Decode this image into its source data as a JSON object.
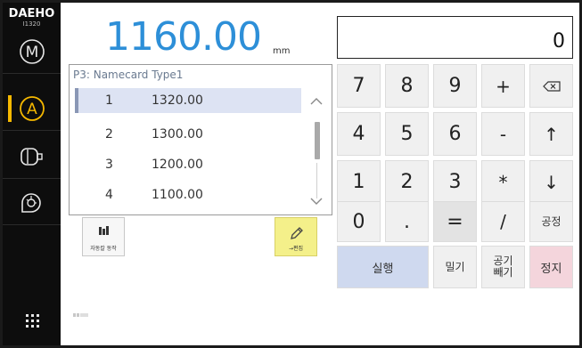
{
  "brand": {
    "name": "DAEHO",
    "model": "I1320"
  },
  "sidebar": {
    "items": [
      {
        "name": "manual-mode",
        "glyph": "M",
        "active": false
      },
      {
        "name": "auto-mode",
        "glyph": "A",
        "active": true
      },
      {
        "name": "motor",
        "active": false
      },
      {
        "name": "blower",
        "active": false
      },
      {
        "name": "menu",
        "active": false
      }
    ],
    "active_color": "#f5b800"
  },
  "display": {
    "value": "1160.00",
    "unit": "mm",
    "value_color": "#2d8fd8"
  },
  "calculator": {
    "display_value": "0"
  },
  "program": {
    "title": "P3: Namecard Type1",
    "rows": [
      {
        "index": "1",
        "value": "1320.00",
        "selected": true
      },
      {
        "index": "2",
        "value": "1300.00",
        "selected": false
      },
      {
        "index": "3",
        "value": "1200.00",
        "selected": false
      },
      {
        "index": "4",
        "value": "1100.00",
        "selected": false
      }
    ]
  },
  "buttons": {
    "auto_run_label": "자동칼 동작",
    "edit_label": "→편집"
  },
  "keypad": {
    "rows": [
      [
        "7",
        "8",
        "9",
        "+",
        "⌫"
      ],
      [
        "4",
        "5",
        "6",
        "-",
        "↑"
      ],
      [
        "1",
        "2",
        "3",
        "*",
        "↓"
      ],
      [
        "0",
        ".",
        "=",
        "/",
        "공정"
      ]
    ],
    "run_label": "실행",
    "push_label": "밀기",
    "air_label_line1": "공기",
    "air_label_line2": "빼기",
    "stop_label": "정지",
    "run_color": "#cfd9ef",
    "stop_color": "#f4d5dc"
  }
}
